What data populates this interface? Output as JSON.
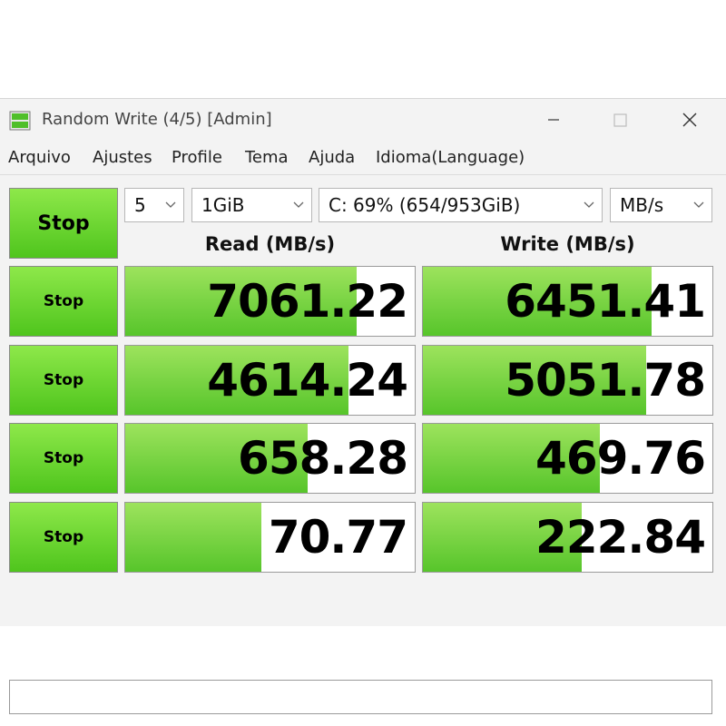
{
  "window": {
    "title": "Random Write (4/5) [Admin]",
    "icons": {
      "app": "disk-app-icon",
      "minimize": "minimize-icon",
      "maximize": "maximize-icon",
      "close": "close-icon"
    }
  },
  "menu": {
    "items": [
      "Arquivo",
      "Ajustes",
      "Profile",
      "Tema",
      "Ajuda",
      "Idioma(Language)"
    ]
  },
  "controls": {
    "stop_all": "Stop",
    "count": "5",
    "size": "1GiB",
    "drive": "C: 69% (654/953GiB)",
    "unit": "MB/s"
  },
  "headers": {
    "read": "Read (MB/s)",
    "write": "Write (MB/s)"
  },
  "rows": [
    {
      "stop": "Stop",
      "read": "7061.22",
      "write": "6451.41",
      "read_fill": 0.8,
      "write_fill": 0.79
    },
    {
      "stop": "Stop",
      "read": "4614.24",
      "write": "5051.78",
      "read_fill": 0.77,
      "write_fill": 0.77
    },
    {
      "stop": "Stop",
      "read": "658.28",
      "write": "469.76",
      "read_fill": 0.63,
      "write_fill": 0.61
    },
    {
      "stop": "Stop",
      "read": "70.77",
      "write": "222.84",
      "read_fill": 0.47,
      "write_fill": 0.55
    }
  ],
  "status": "",
  "colors": {
    "accent_green": "#57c52b",
    "accent_green_light": "#9de35d",
    "window_bg": "#f3f3f3"
  }
}
